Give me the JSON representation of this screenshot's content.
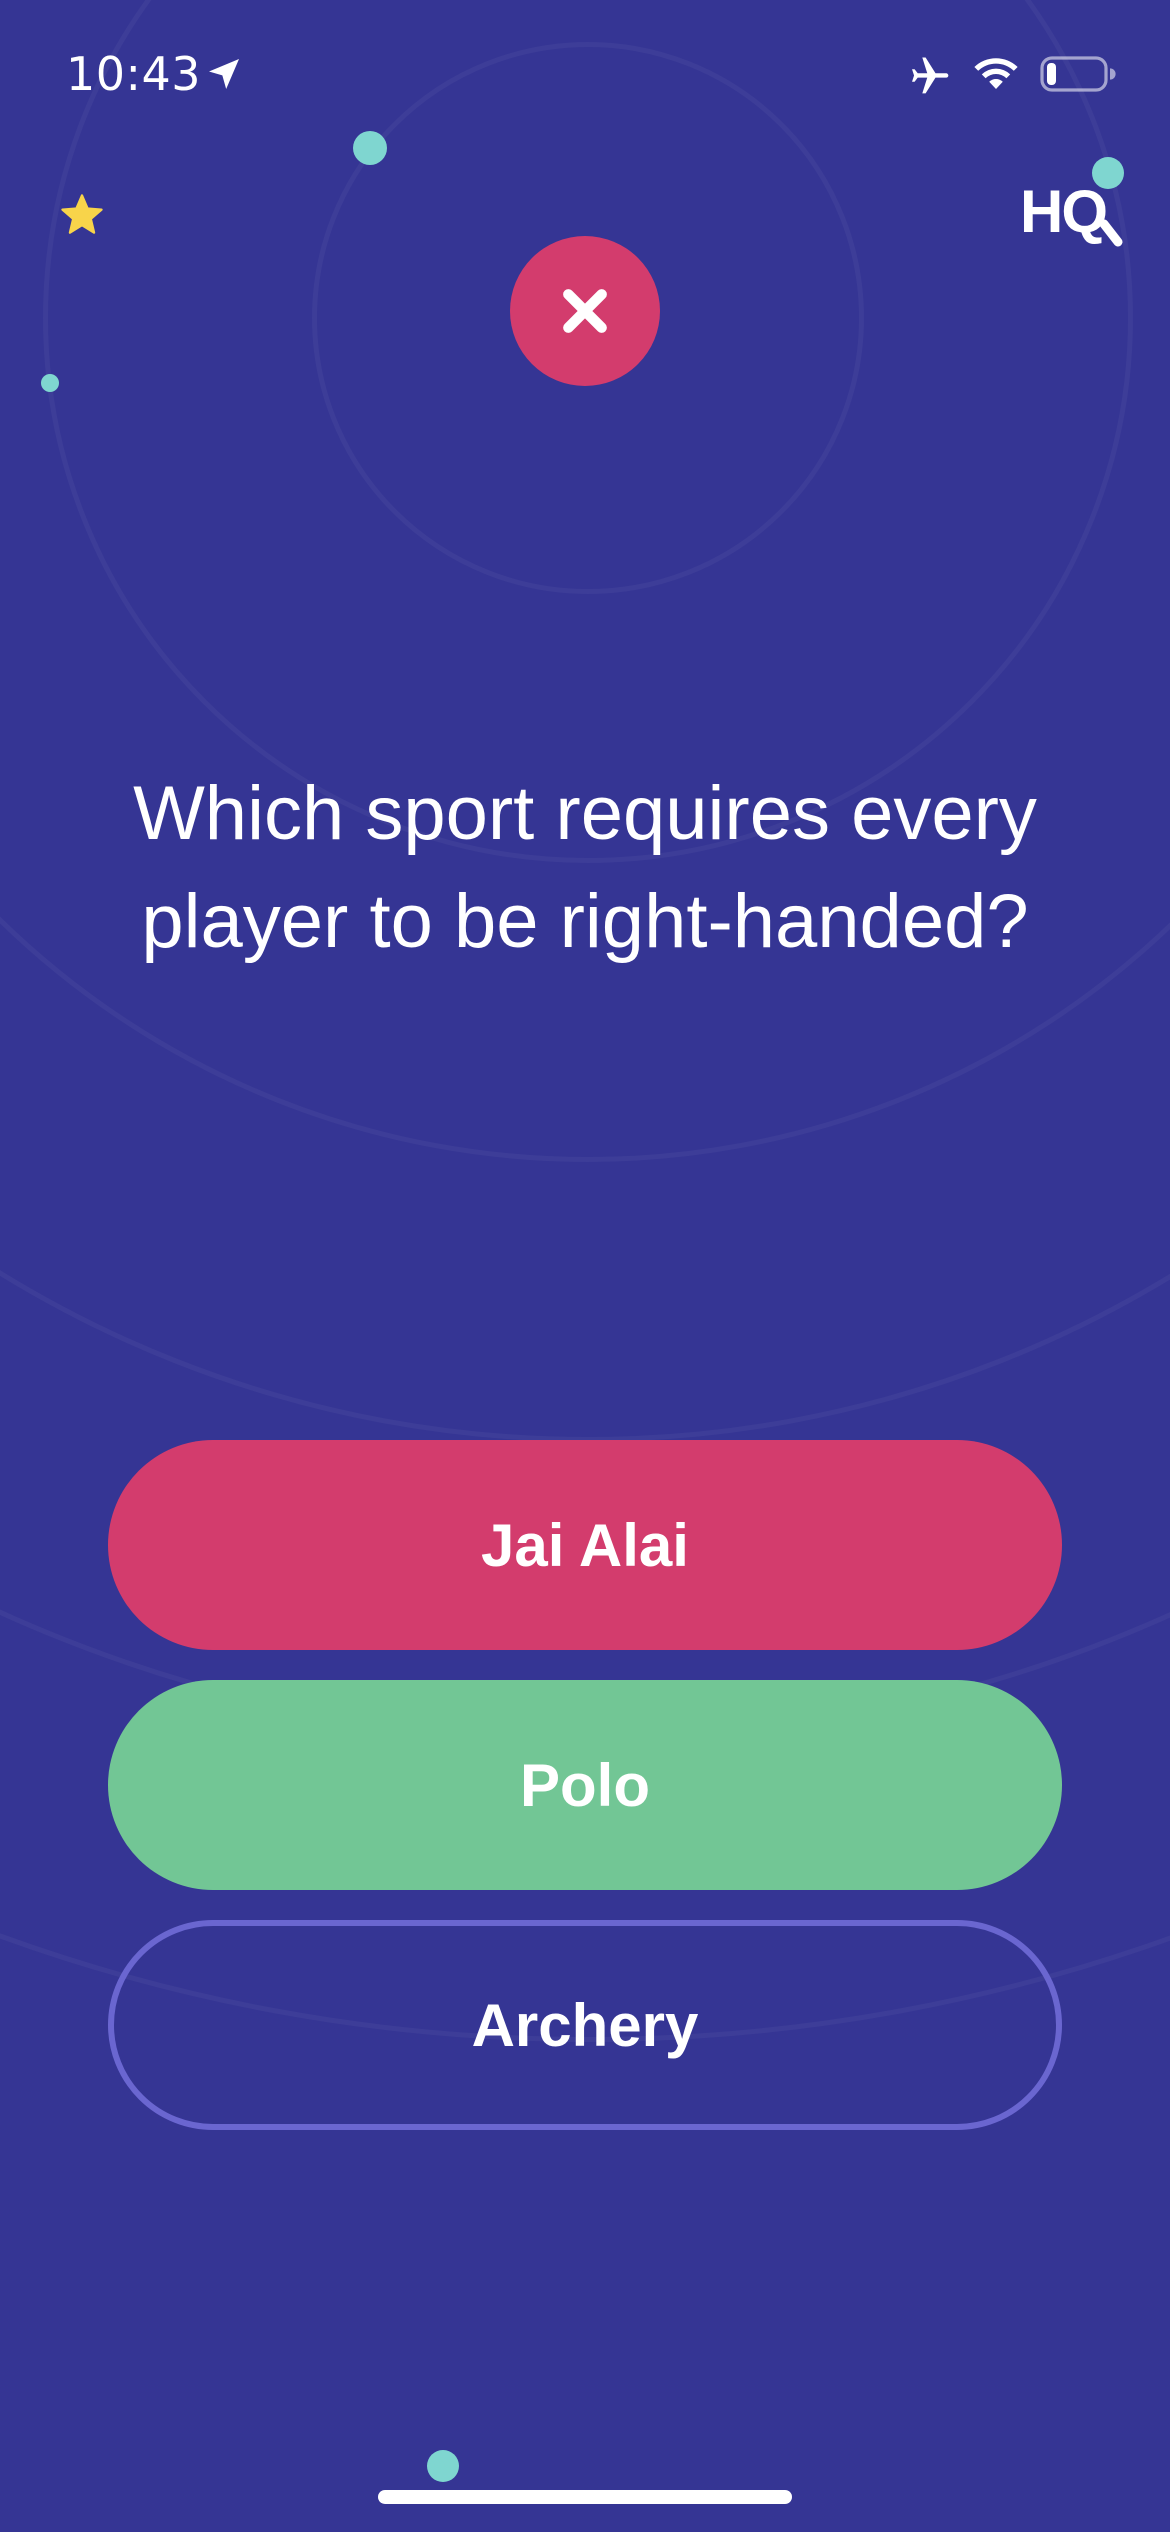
{
  "status_bar": {
    "time": "10:43",
    "icons": [
      "location-arrow-icon",
      "airplane-icon",
      "wifi-icon",
      "battery-icon"
    ],
    "battery_level": 0.15
  },
  "brand": {
    "logo_text": "HQ"
  },
  "result": {
    "icon": "x-icon",
    "state": "incorrect"
  },
  "question": {
    "text": "Which sport requires every player to be right-handed?"
  },
  "answers": [
    {
      "label": "Jai Alai",
      "state": "selected-wrong",
      "color": "#d33c6d"
    },
    {
      "label": "Polo",
      "state": "correct",
      "color": "#72c695"
    },
    {
      "label": "Archery",
      "state": "neutral",
      "color": "#6a66d0"
    }
  ],
  "colors": {
    "background": "#353594",
    "wrong": "#d33c6d",
    "correct": "#72c695",
    "outline": "#6a66d0",
    "accent_dot": "#7fd6d0",
    "star": "#f8d44a"
  }
}
